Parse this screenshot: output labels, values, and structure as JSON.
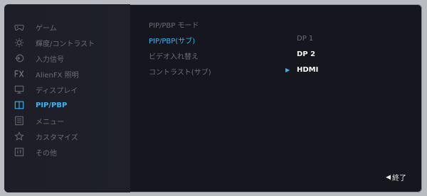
{
  "sidebar": {
    "items": [
      {
        "label": "ゲーム",
        "icon": "gamepad-icon"
      },
      {
        "label": "輝度/コントラスト",
        "icon": "brightness-icon"
      },
      {
        "label": "入力信号",
        "icon": "input-source-icon"
      },
      {
        "label": "AlienFX 照明",
        "icon": "fx-icon"
      },
      {
        "label": "ディスプレイ",
        "icon": "monitor-icon"
      },
      {
        "label": "PIP/PBP",
        "icon": "pip-pbp-icon"
      },
      {
        "label": "メニュー",
        "icon": "menu-icon"
      },
      {
        "label": "カスタマイズ",
        "icon": "star-icon"
      },
      {
        "label": "その他",
        "icon": "info-icon"
      }
    ],
    "active_index": 5
  },
  "content": {
    "rows": [
      {
        "label": "PIP/PBP モード"
      },
      {
        "label": "PIP/PBP(サブ)"
      },
      {
        "label": "ビデオ入れ替え"
      },
      {
        "label": "コントラスト(サブ)"
      }
    ],
    "active_row": 1,
    "options": [
      "DP 1",
      "DP 2",
      "HDMI"
    ],
    "selected_option": "DP 2",
    "highlighted_option": "HDMI"
  },
  "footer": {
    "exit_label": "終了"
  },
  "colors": {
    "accent": "#38b5f4",
    "panel": "#16161e",
    "sidebar": "#1f2029",
    "muted": "#6a6c78"
  }
}
